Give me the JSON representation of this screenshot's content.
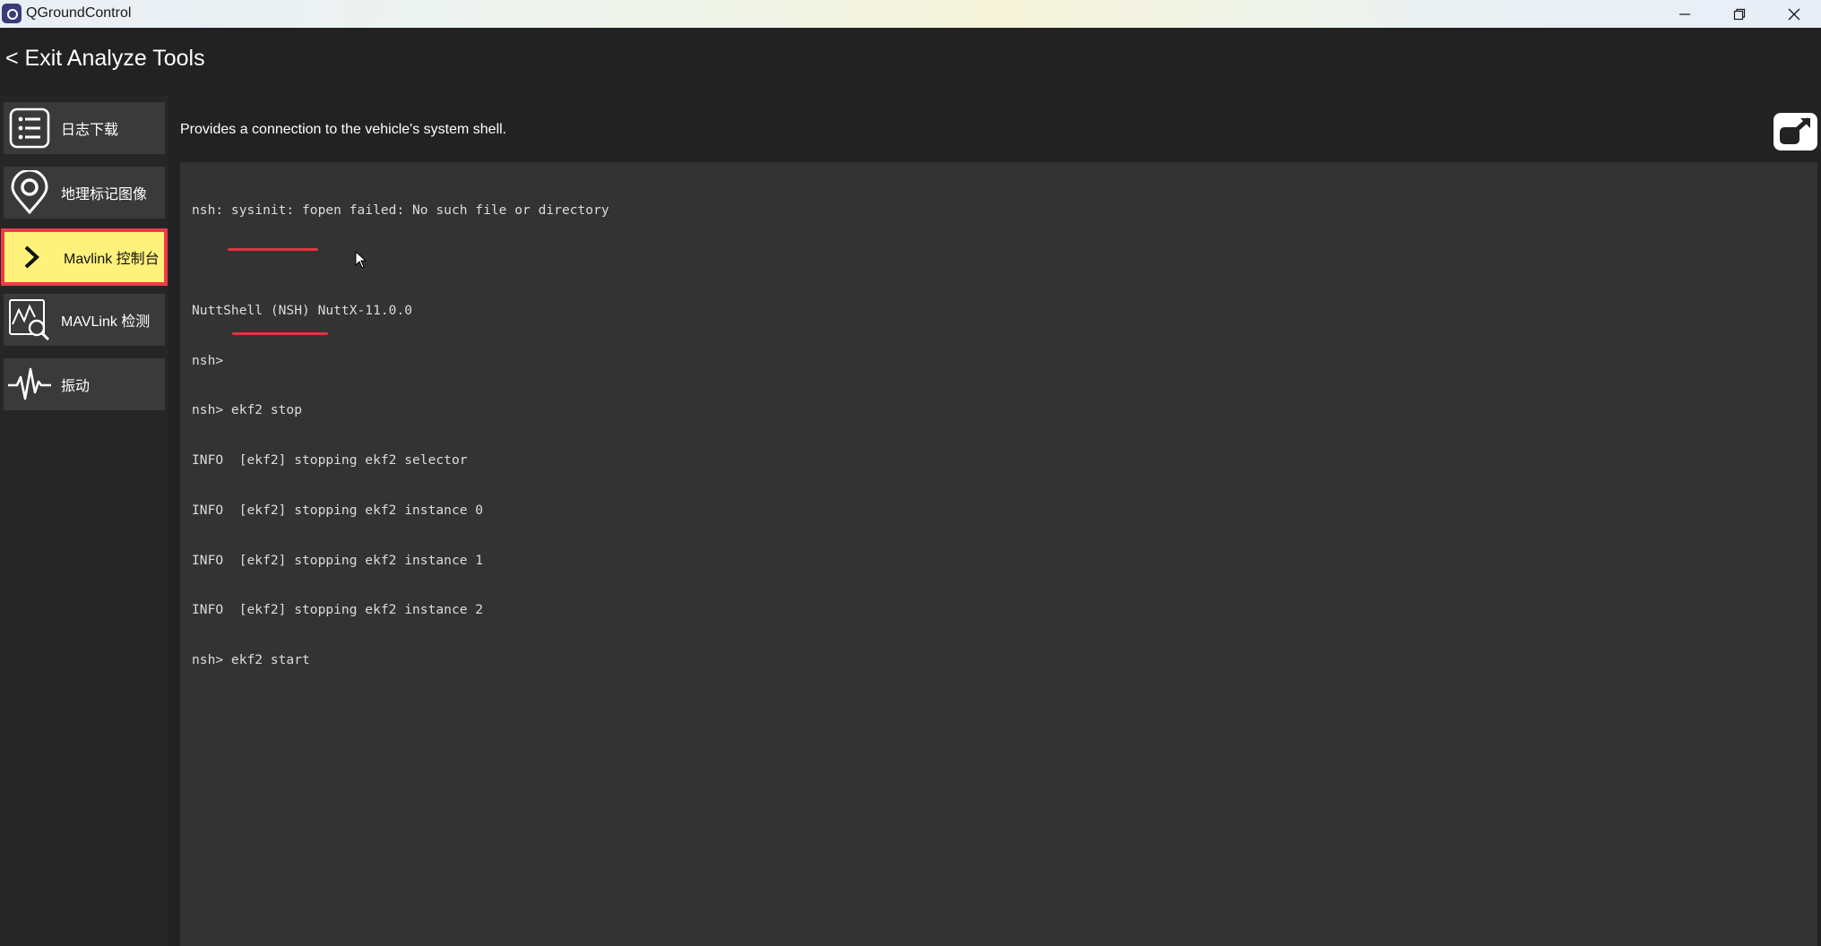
{
  "window": {
    "title": "QGroundControl",
    "controls": [
      "minimize-icon",
      "restore-icon",
      "close-icon"
    ]
  },
  "header": {
    "exit_label": "< Exit Analyze Tools"
  },
  "sidebar": {
    "items": [
      {
        "label": "日志下载",
        "icon": "list-icon",
        "active": false
      },
      {
        "label": "地理标记图像",
        "icon": "location-pin-icon",
        "active": false
      },
      {
        "label": "Mavlink 控制台",
        "icon": "chevron-right-icon",
        "active": true
      },
      {
        "label": "MAVLink 检测",
        "icon": "chart-inspect-icon",
        "active": false
      },
      {
        "label": "振动",
        "icon": "waveform-icon",
        "active": false
      }
    ]
  },
  "main": {
    "description": "Provides a connection to the vehicle's system shell.",
    "popout_icon": "popout-window-icon",
    "console": {
      "lines": [
        "nsh: sysinit: fopen failed: No such file or directory",
        "",
        "NuttShell (NSH) NuttX-11.0.0",
        "nsh>",
        "nsh> ekf2 stop",
        "INFO  [ekf2] stopping ekf2 selector",
        "INFO  [ekf2] stopping ekf2 instance 0",
        "INFO  [ekf2] stopping ekf2 instance 1",
        "INFO  [ekf2] stopping ekf2 instance 2",
        "nsh> ekf2 start"
      ]
    }
  },
  "colors": {
    "background": "#222222",
    "sidebar_item": "#3a3a3a",
    "active_item": "#fff27a",
    "highlight_border": "#ee3b4c",
    "console_bg": "#333333",
    "annotation_underline": "#e8333f"
  }
}
